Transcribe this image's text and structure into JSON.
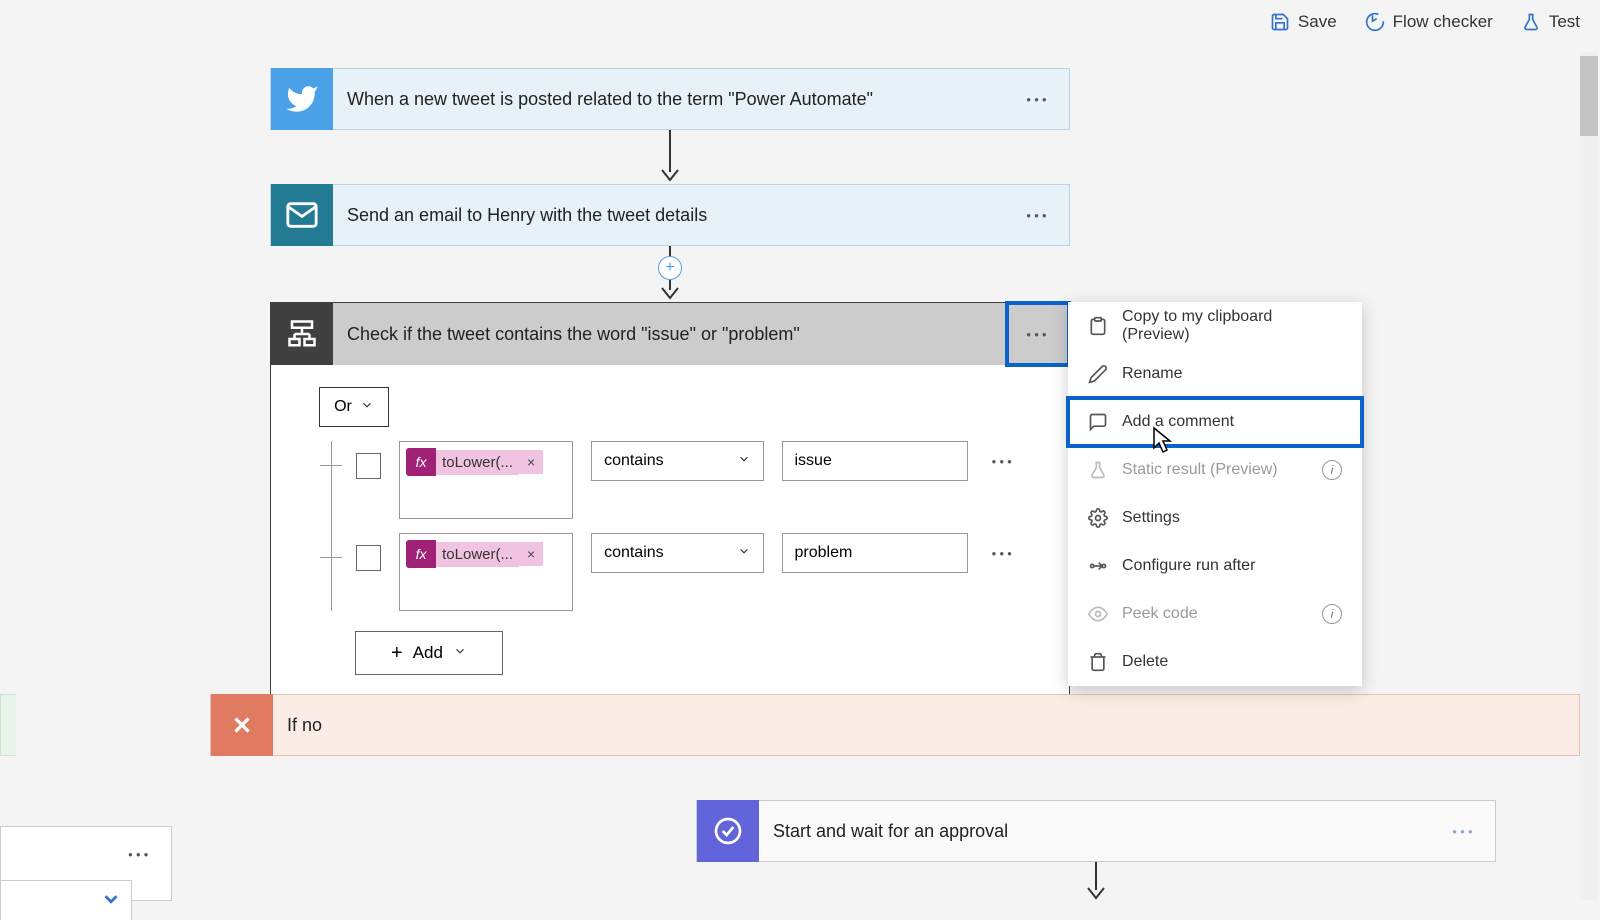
{
  "toolbar": {
    "save": "Save",
    "flow_checker": "Flow checker",
    "test": "Test"
  },
  "steps": {
    "trigger": {
      "title": "When a new tweet is posted related to the term \"Power Automate\""
    },
    "email": {
      "title": "Send an email to Henry with the tweet details"
    },
    "condition": {
      "title": "Check if the tweet contains the word \"issue\" or \"problem\"",
      "logic": "Or",
      "rows": [
        {
          "fx": "toLower(...",
          "op": "contains",
          "val": "issue"
        },
        {
          "fx": "toLower(...",
          "op": "contains",
          "val": "problem"
        }
      ],
      "add": "Add"
    },
    "if_no": {
      "title": "If no"
    },
    "approval": {
      "title": "Start and wait for an approval"
    }
  },
  "menu": {
    "copy": "Copy to my clipboard (Preview)",
    "rename": "Rename",
    "comment": "Add a comment",
    "static": "Static result (Preview)",
    "settings": "Settings",
    "configure": "Configure run after",
    "peek": "Peek code",
    "delete": "Delete"
  },
  "fx_label": "fx"
}
